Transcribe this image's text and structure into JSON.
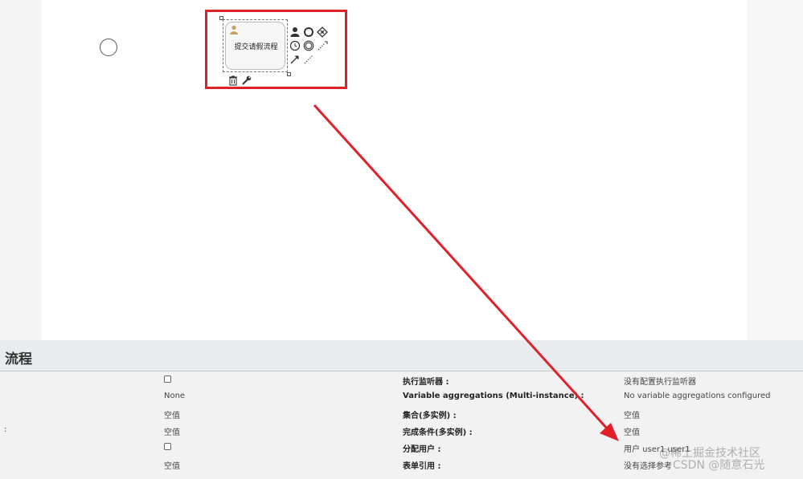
{
  "canvas": {
    "user_task_label": "提交请假流程"
  },
  "properties_panel": {
    "title": "流程",
    "rows": [
      {
        "value1_type": "checkbox",
        "value1": "",
        "key2": "执行监听器 :",
        "value2": "没有配置执行监听器"
      },
      {
        "value1_type": "text",
        "value1": "None",
        "key2": "Variable aggregations (Multi-instance) :",
        "value2": "No variable aggregations configured"
      },
      {
        "value1_type": "text",
        "value1": "空值",
        "key2": "集合(多实例) :",
        "value2": "空值"
      },
      {
        "value1_type": "text",
        "value1": "空值",
        "key2": "完成条件(多实例) :",
        "value2": "空值",
        "stub": ":"
      },
      {
        "value1_type": "checkbox",
        "value1": "",
        "key2": "分配用户 :",
        "value2": "用户 user1 user1"
      },
      {
        "value1_type": "text",
        "value1": "空值",
        "key2": "表单引用 :",
        "value2": "没有选择参考"
      }
    ]
  },
  "watermark": {
    "line1": "@稀土掘金技术社区",
    "line2": "CSDN @随意石光"
  },
  "colors": {
    "highlight": "#e2202a",
    "panel_header": "#e8ecee",
    "panel_body": "#f2f2f2"
  },
  "icons": [
    "user-icon",
    "end-event-icon",
    "gateway-icon",
    "timer-event-icon",
    "intermediate-event-icon",
    "connection-icon",
    "text-annotation-icon",
    "association-icon",
    "delete-icon",
    "wrench-icon"
  ]
}
